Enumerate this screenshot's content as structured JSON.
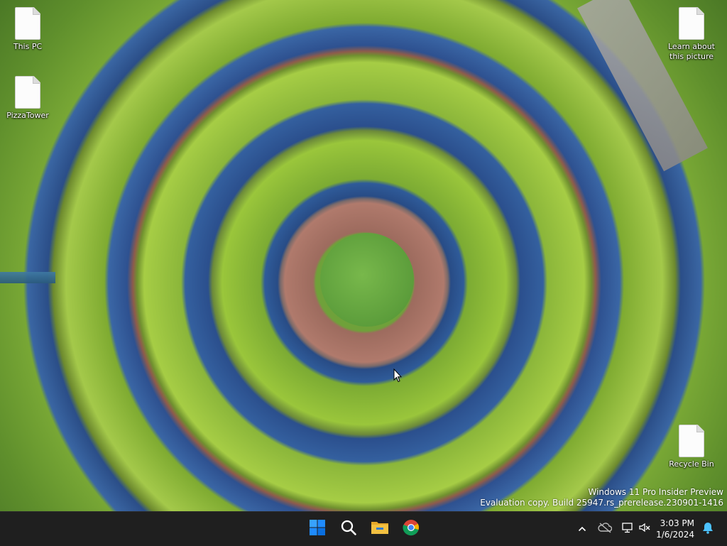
{
  "desktop": {
    "icons": [
      {
        "label": "This PC",
        "icon": "file-icon"
      },
      {
        "label": "PizzaTower",
        "icon": "file-icon"
      },
      {
        "label": "Learn about this picture",
        "icon": "file-icon"
      },
      {
        "label": "Recycle Bin",
        "icon": "file-icon"
      }
    ],
    "watermark": {
      "line1": "Windows 11 Pro Insider Preview",
      "line2": "Evaluation copy. Build 25947.rs_prerelease.230901-1416"
    }
  },
  "taskbar": {
    "apps": [
      {
        "name": "Start",
        "icon": "windows-start-icon"
      },
      {
        "name": "Search",
        "icon": "search-icon"
      },
      {
        "name": "File Explorer",
        "icon": "folder-icon"
      },
      {
        "name": "Google Chrome",
        "icon": "chrome-icon"
      }
    ],
    "tray": {
      "icons": [
        "chevron-up-icon",
        "onedrive-icon",
        "network-icon",
        "volume-muted-icon",
        "notification-bell-icon"
      ]
    },
    "clock": {
      "time": "3:03 PM",
      "date": "1/6/2024"
    }
  },
  "colors": {
    "taskbar_bg": "#1f1f1f",
    "accent_blue": "#0a84ff",
    "folder_yellow": "#f3c041",
    "chrome_red": "#db4437",
    "chrome_green": "#0f9d58",
    "chrome_yellow": "#f4b400"
  }
}
